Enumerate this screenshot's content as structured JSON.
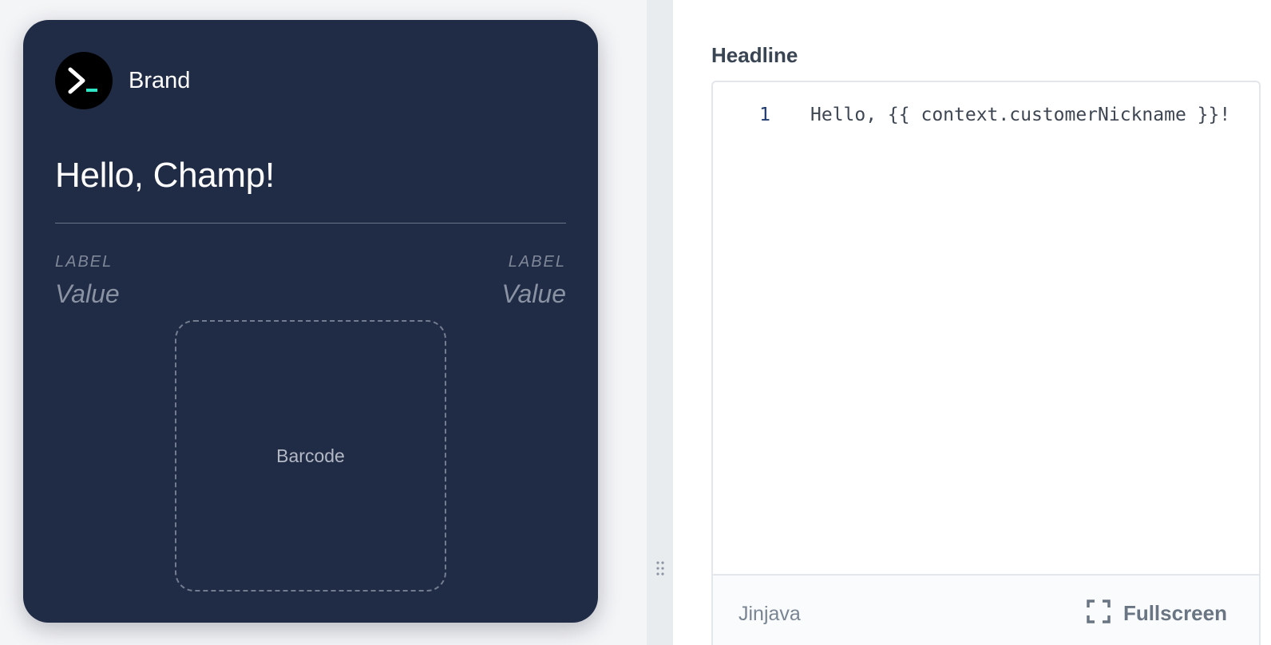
{
  "preview": {
    "brand_name": "Brand",
    "headline": "Hello, Champ!",
    "fields": [
      {
        "label": "LABEL",
        "value": "Value"
      },
      {
        "label": "LABEL",
        "value": "Value"
      }
    ],
    "barcode_label": "Barcode",
    "icons": {
      "logo": "terminal-prompt-icon"
    },
    "colors": {
      "card_bg": "#202b45",
      "logo_accent": "#2ee6c6"
    }
  },
  "splitter": {
    "icon": "drag-handle-icon"
  },
  "editor": {
    "title": "Headline",
    "lines": [
      {
        "number": "1",
        "code": "Hello, {{ context.customerNickname }}!"
      }
    ],
    "mode": "Jinjava",
    "fullscreen_label": "Fullscreen",
    "icons": {
      "fullscreen": "fullscreen-icon"
    }
  }
}
